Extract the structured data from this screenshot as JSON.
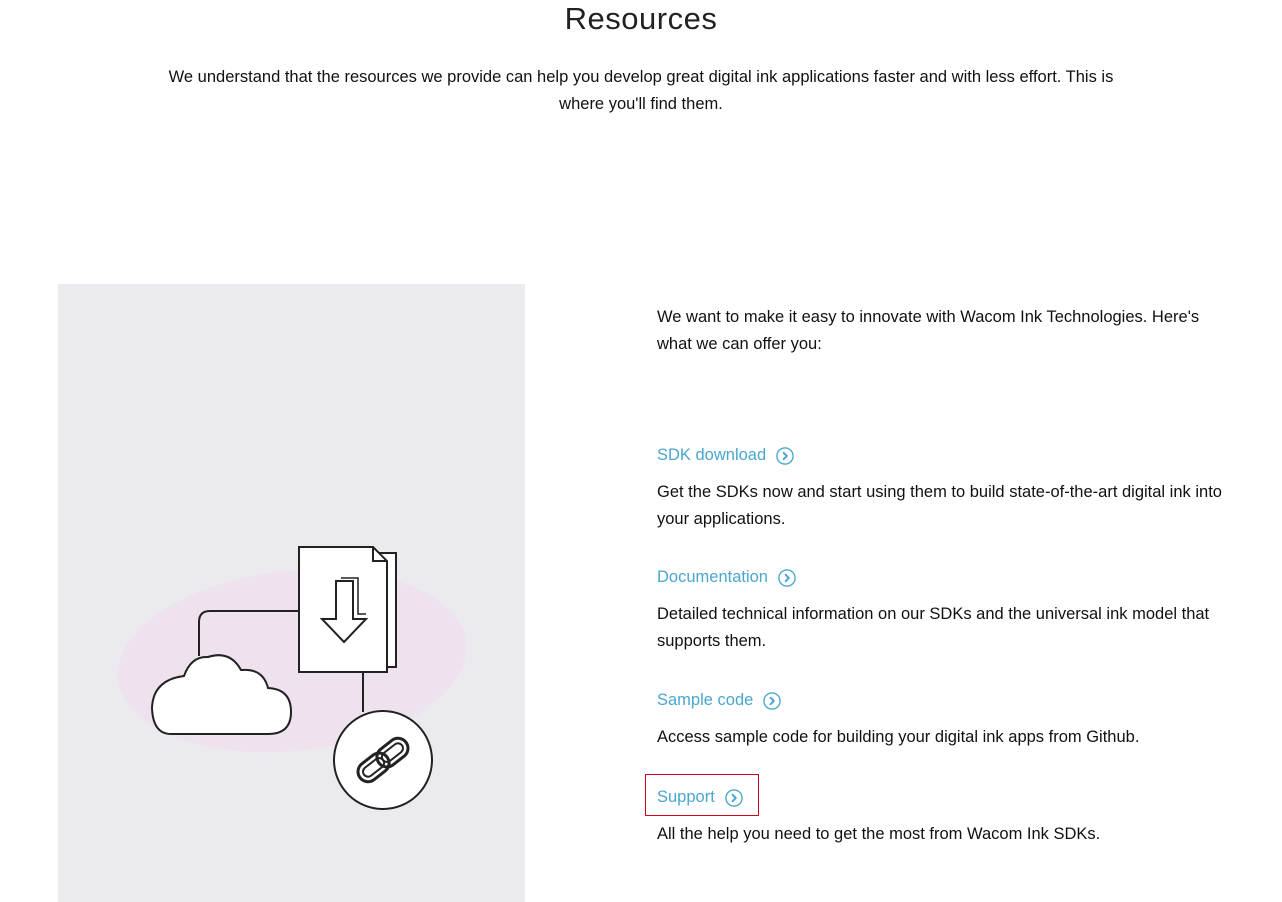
{
  "header": {
    "title": "Resources",
    "intro": "We understand that the resources we provide can help you develop great digital ink applications faster and with less effort. This is where you'll find them."
  },
  "main": {
    "lead": "We want to make it easy to innovate with Wacom Ink Technologies. Here's what we can offer you:",
    "resources": [
      {
        "label": "SDK download",
        "description": "Get the SDKs now and start using them to build state-of-the-art digital ink into your applications."
      },
      {
        "label": "Documentation",
        "description": "Detailed technical information on our SDKs and the universal ink model that supports them."
      },
      {
        "label": "Sample code",
        "description": "Access sample code for building your digital ink apps from Github."
      },
      {
        "label": "Support",
        "description": "All the help you need to get the most from Wacom Ink SDKs."
      }
    ]
  },
  "illustration": {
    "icons": [
      "cloud-icon",
      "document-download-icon",
      "chain-link-icon"
    ]
  },
  "colors": {
    "link": "#4aa6cf",
    "panel_bg": "#ebebef",
    "blob": "#ede2ee",
    "highlight": "#d0021b"
  }
}
